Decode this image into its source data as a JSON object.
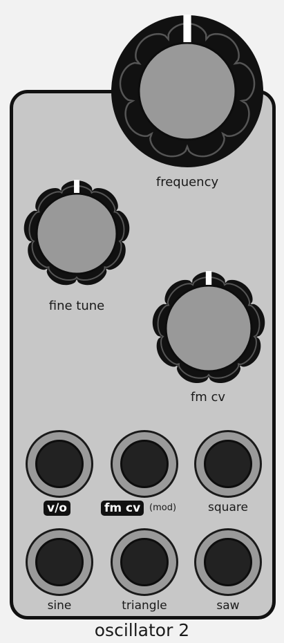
{
  "module": {
    "title": "oscillator 2"
  },
  "knobs": {
    "frequency": "frequency",
    "fine_tune": "fine tune",
    "fm_cv": "fm cv"
  },
  "jacks": {
    "vo": "v/o",
    "fm_cv": "fm cv",
    "fm_cv_note": "(mod)",
    "square": "square",
    "sine": "sine",
    "triangle": "triangle",
    "saw": "saw"
  },
  "colors": {
    "panel": "#c7c7c7",
    "knob_body": "#111111",
    "knob_cap": "#999999",
    "jack_ring": "#9a9a9a",
    "jack_hole": "#222222"
  }
}
